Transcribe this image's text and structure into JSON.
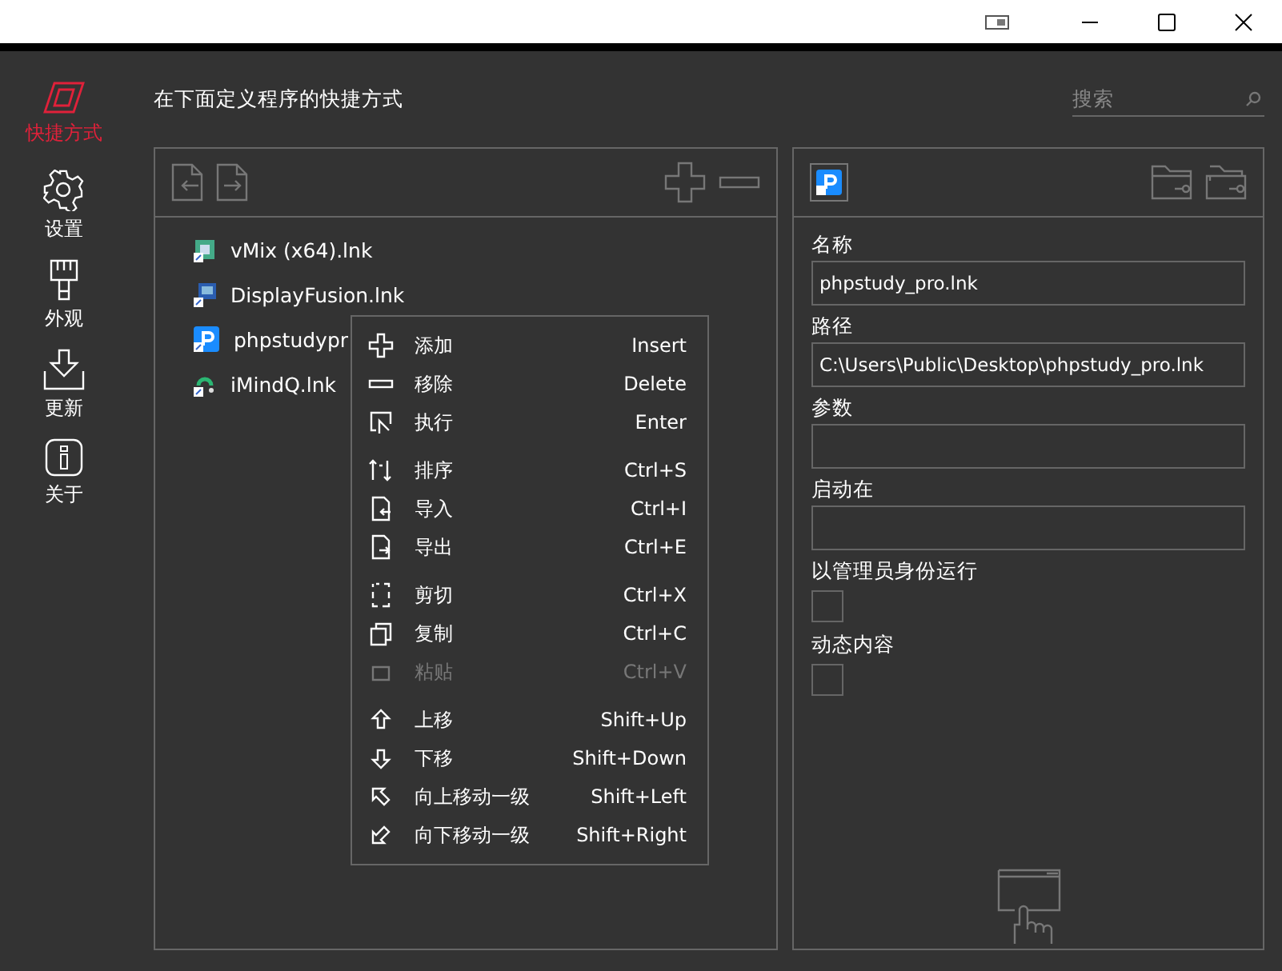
{
  "sidebar": {
    "items": [
      {
        "label": "快捷方式",
        "selected": true
      },
      {
        "label": "设置",
        "selected": false
      },
      {
        "label": "外观",
        "selected": false
      },
      {
        "label": "更新",
        "selected": false
      },
      {
        "label": "关于",
        "selected": false
      }
    ]
  },
  "header": {
    "title": "在下面定义程序的快捷方式",
    "search": {
      "placeholder": "搜索"
    }
  },
  "shortcuts": [
    {
      "label": "vMix (x64).lnk",
      "selected": false
    },
    {
      "label": "DisplayFusion.lnk",
      "selected": false
    },
    {
      "label": "phpstudypr",
      "selected": false
    },
    {
      "label": "iMindQ.lnk",
      "selected": false
    }
  ],
  "context_menu": {
    "groups": [
      [
        {
          "label": "添加",
          "shortcut": "Insert",
          "disabled": false
        },
        {
          "label": "移除",
          "shortcut": "Delete",
          "disabled": false
        },
        {
          "label": "执行",
          "shortcut": "Enter",
          "disabled": false
        }
      ],
      [
        {
          "label": "排序",
          "shortcut": "Ctrl+S",
          "disabled": false
        },
        {
          "label": "导入",
          "shortcut": "Ctrl+I",
          "disabled": false
        },
        {
          "label": "导出",
          "shortcut": "Ctrl+E",
          "disabled": false
        }
      ],
      [
        {
          "label": "剪切",
          "shortcut": "Ctrl+X",
          "disabled": false
        },
        {
          "label": "复制",
          "shortcut": "Ctrl+C",
          "disabled": false
        },
        {
          "label": "粘贴",
          "shortcut": "Ctrl+V",
          "disabled": true
        }
      ],
      [
        {
          "label": "上移",
          "shortcut": "Shift+Up",
          "disabled": false
        },
        {
          "label": "下移",
          "shortcut": "Shift+Down",
          "disabled": false
        },
        {
          "label": "向上移动一级",
          "shortcut": "Shift+Left",
          "disabled": false
        },
        {
          "label": "向下移动一级",
          "shortcut": "Shift+Right",
          "disabled": false
        }
      ]
    ]
  },
  "details": {
    "fields": [
      {
        "kind": "text",
        "label": "名称",
        "value": "phpstudy_pro.lnk"
      },
      {
        "kind": "text",
        "label": "路径",
        "value": "C:\\Users\\Public\\Desktop\\phpstudy_pro.lnk"
      },
      {
        "kind": "text",
        "label": "参数"
      },
      {
        "kind": "text",
        "label": "启动在"
      },
      {
        "kind": "checkbox",
        "label": "以管理员身份运行",
        "checked": false
      },
      {
        "kind": "checkbox",
        "label": "动态内容",
        "checked": false
      }
    ]
  }
}
